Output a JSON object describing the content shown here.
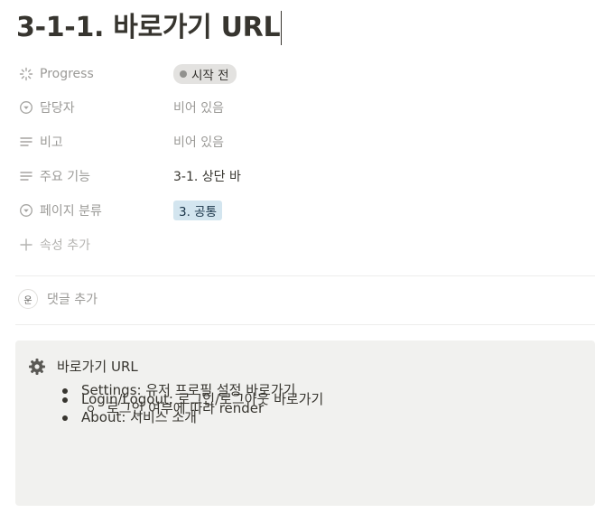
{
  "page": {
    "title": "3-1-1. 바로가기 URL"
  },
  "properties": {
    "progress": {
      "label": "Progress",
      "value": "시작 전",
      "icon": "spinner-icon",
      "pill_color": "#e3e2e0"
    },
    "assignee": {
      "label": "담당자",
      "value": "비어 있음",
      "icon": "person-select-icon"
    },
    "notes": {
      "label": "비고",
      "value": "비어 있음",
      "icon": "text-lines-icon"
    },
    "main_feature": {
      "label": "주요 기능",
      "value": "3-1. 상단 바",
      "icon": "text-lines-icon"
    },
    "page_category": {
      "label": "페이지 분류",
      "value": "3. 공통",
      "icon": "select-icon",
      "tag_color": "#d3e5ef"
    },
    "add_property": {
      "label": "속성 추가",
      "icon": "plus-icon"
    }
  },
  "comments": {
    "avatar": "운",
    "add_label": "댓글 추가"
  },
  "callout": {
    "icon": "gear-icon",
    "title": "바로가기 URL",
    "items": [
      {
        "text": "Settings: 유저 프로필 설정 바로가기"
      },
      {
        "text": "Login/Logout: 로그인/로그아웃 바로가기"
      },
      {
        "text": "로그인 여부에 따라 render"
      },
      {
        "text": "About: 서비스 소개"
      }
    ]
  }
}
